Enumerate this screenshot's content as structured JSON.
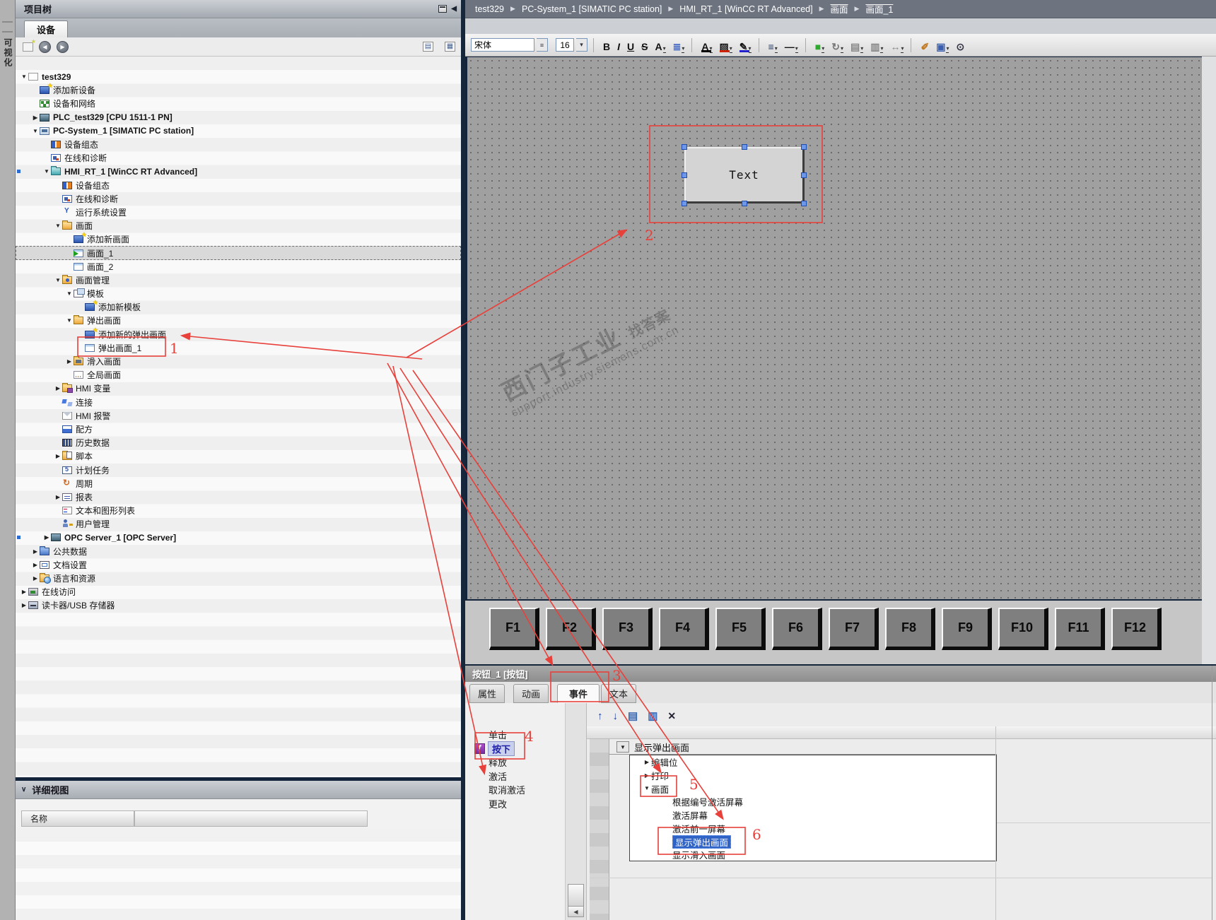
{
  "edge": {
    "vertical_label": "可视化"
  },
  "project_tree": {
    "title": "项目树",
    "device_tab": "设备",
    "detail_view_title": "详细视图",
    "name_header": "名称",
    "items": [
      {
        "t": "test329",
        "lv": 0,
        "ar": "d",
        "ic": "proj",
        "bold": true
      },
      {
        "t": "添加新设备",
        "lv": 1,
        "ic": "add st"
      },
      {
        "t": "设备和网络",
        "lv": 1,
        "ic": "net"
      },
      {
        "t": "PLC_test329 [CPU 1511-1 PN]",
        "lv": 1,
        "ar": "r",
        "ic": "plc",
        "bold": true
      },
      {
        "t": "PC-System_1 [SIMATIC PC station]",
        "lv": 1,
        "ar": "d",
        "ic": "pc",
        "bold": true
      },
      {
        "t": "设备组态",
        "lv": 2,
        "ic": "cfg"
      },
      {
        "t": "在线和诊断",
        "lv": 2,
        "ic": "diag"
      },
      {
        "t": "HMI_RT_1 [WinCC RT Advanced]",
        "lv": 2,
        "ar": "d",
        "ic": "hmi",
        "bold": true,
        "dot": true
      },
      {
        "t": "设备组态",
        "lv": 3,
        "ic": "cfg"
      },
      {
        "t": "在线和诊断",
        "lv": 3,
        "ic": "diag"
      },
      {
        "t": "运行系统设置",
        "lv": 3,
        "ic": "runtime bare"
      },
      {
        "t": "画面",
        "lv": 3,
        "ar": "d",
        "ic": "fld"
      },
      {
        "t": "添加新画面",
        "lv": 4,
        "ic": "addscr st"
      },
      {
        "t": "画面_1",
        "lv": 4,
        "ic": "scrplay",
        "sel": true
      },
      {
        "t": "画面_2",
        "lv": 4,
        "ic": "scr"
      },
      {
        "t": "画面管理",
        "lv": 3,
        "ar": "d",
        "ic": "fldw"
      },
      {
        "t": "模板",
        "lv": 4,
        "ar": "d",
        "ic": "tpl"
      },
      {
        "t": "添加新模板",
        "lv": 5,
        "ic": "addscr st"
      },
      {
        "t": "弹出画面",
        "lv": 4,
        "ar": "d",
        "ic": "fld"
      },
      {
        "t": "添加新的弹出画面",
        "lv": 5,
        "ic": "addscr st"
      },
      {
        "t": "弹出画面_1",
        "lv": 5,
        "ic": "scr"
      },
      {
        "t": "滑入画面",
        "lv": 4,
        "ar": "r",
        "ic": "fldd"
      },
      {
        "t": "全局画面",
        "lv": 4,
        "ic": "global"
      },
      {
        "t": "HMI 变量",
        "lv": 3,
        "ar": "r",
        "ic": "varfld"
      },
      {
        "t": "连接",
        "lv": 3,
        "ic": "conn bare"
      },
      {
        "t": "HMI 报警",
        "lv": 3,
        "ic": "alarm"
      },
      {
        "t": "配方",
        "lv": 3,
        "ic": "recipe"
      },
      {
        "t": "历史数据",
        "lv": 3,
        "ic": "hist"
      },
      {
        "t": "脚本",
        "lv": 3,
        "ar": "r",
        "ic": "scriptfld"
      },
      {
        "t": "计划任务",
        "lv": 3,
        "ic": "sched"
      },
      {
        "t": "周期",
        "lv": 3,
        "ic": "cycle bare"
      },
      {
        "t": "报表",
        "lv": 3,
        "ar": "r",
        "ic": "report"
      },
      {
        "t": "文本和图形列表",
        "lv": 3,
        "ic": "txtlist"
      },
      {
        "t": "用户管理",
        "lv": 3,
        "ic": "users bare"
      },
      {
        "t": "OPC Server_1 [OPC Server]",
        "lv": 2,
        "ar": "r",
        "ic": "opc",
        "bold": true,
        "dot": true
      },
      {
        "t": "公共数据",
        "lv": 1,
        "ar": "r",
        "ic": "common"
      },
      {
        "t": "文档设置",
        "lv": 1,
        "ar": "r",
        "ic": "docset"
      },
      {
        "t": "语言和资源",
        "lv": 1,
        "ar": "r",
        "ic": "lang"
      },
      {
        "t": "在线访问",
        "lv": 0,
        "ar": "r",
        "ic": "online"
      },
      {
        "t": "读卡器/USB 存储器",
        "lv": 0,
        "ar": "r",
        "ic": "card"
      }
    ]
  },
  "breadcrumb": {
    "items": [
      "test329",
      "PC-System_1 [SIMATIC PC station]",
      "HMI_RT_1 [WinCC RT Advanced]",
      "画面",
      "画面_1"
    ]
  },
  "format_toolbar": {
    "font_name": "宋体",
    "font_size": "16",
    "buttons": [
      {
        "name": "bold",
        "glyph": "B"
      },
      {
        "name": "italic",
        "glyph": "I",
        "cls": "it"
      },
      {
        "name": "underline",
        "glyph": "U",
        "cls": "un"
      },
      {
        "name": "strikethrough",
        "glyph": "S",
        "cls": "stk"
      },
      {
        "name": "font-size-adjust",
        "glyph": "A",
        "dd": true
      },
      {
        "name": "alignment",
        "glyph": "≣",
        "dd": true,
        "color": "#2b57c2"
      },
      {
        "sep": true
      },
      {
        "name": "font-color",
        "glyph": "A",
        "bar": "#000000",
        "dd": true
      },
      {
        "name": "background-color",
        "glyph": "▨",
        "bar": "#cc2200",
        "dd": true
      },
      {
        "name": "border-color",
        "glyph": "✎",
        "bar": "#2222cc",
        "dd": true
      },
      {
        "sep": true
      },
      {
        "name": "border-style",
        "glyph": "≡",
        "dd": true,
        "color": "#223a66"
      },
      {
        "name": "line-style",
        "glyph": "―",
        "dd": true
      },
      {
        "sep": true
      },
      {
        "name": "object-color",
        "glyph": "■",
        "dd": true,
        "color": "#2faa2f"
      },
      {
        "name": "rotate",
        "glyph": "↻",
        "dd": true,
        "color": "#777777"
      },
      {
        "name": "align-objects",
        "glyph": "▤",
        "dd": true,
        "color": "#888888"
      },
      {
        "name": "distribute-objects",
        "glyph": "▥",
        "dd": true,
        "color": "#888888"
      },
      {
        "name": "size-objects",
        "glyph": "↔",
        "dd": true,
        "color": "#888888"
      },
      {
        "sep": true
      },
      {
        "name": "format-paint",
        "glyph": "✐",
        "color": "#c07820"
      },
      {
        "name": "layers",
        "glyph": "▣",
        "dd": true,
        "color": "#3a5fae"
      },
      {
        "name": "zoom-select",
        "glyph": "⊙",
        "color": "#333344"
      }
    ]
  },
  "canvas": {
    "button_label": "Text",
    "watermark_main": "西门子工业",
    "watermark_tag": "找答案",
    "watermark_url": "support.industry.siemens.com.cn",
    "fkeys": [
      "F1",
      "F2",
      "F3",
      "F4",
      "F5",
      "F6",
      "F7",
      "F8",
      "F9",
      "F10",
      "F11",
      "F12"
    ]
  },
  "properties_panel": {
    "title": "按钮_1 [按钮]",
    "tabs": [
      "属性",
      "动画",
      "事件",
      "文本"
    ],
    "active_tab": "事件",
    "events": [
      {
        "label": "单击"
      },
      {
        "label": "按下",
        "selected": true
      },
      {
        "label": "释放"
      },
      {
        "label": "激活"
      },
      {
        "label": "取消激活"
      },
      {
        "label": "更改"
      }
    ],
    "function_toolbar": [
      {
        "name": "move-up",
        "glyph": "↑",
        "cls": "fi"
      },
      {
        "name": "move-down",
        "glyph": "↓",
        "cls": "fi"
      },
      {
        "name": "expand-all",
        "glyph": "▤",
        "cls": "fi f"
      },
      {
        "name": "collapse-all",
        "glyph": "▥",
        "cls": "fi f"
      },
      {
        "name": "delete",
        "glyph": "✕",
        "cls": "fi x"
      }
    ],
    "selected_function": "显示弹出画面",
    "function_tree": [
      {
        "label": "编辑位",
        "lv": 1,
        "ar": "r"
      },
      {
        "label": "打印",
        "lv": 1,
        "ar": "r"
      },
      {
        "label": "画面",
        "lv": 1,
        "ar": "d"
      },
      {
        "label": "根据编号激活屏幕",
        "lv": 2
      },
      {
        "label": "激活屏幕",
        "lv": 2
      },
      {
        "label": "激活前一屏幕",
        "lv": 2
      },
      {
        "label": "显示弹出画面",
        "lv": 2,
        "selected": true
      },
      {
        "label": "显示滑入画面",
        "lv": 2
      }
    ]
  },
  "annotations": {
    "n1": "1",
    "n2": "2",
    "n3": "3",
    "n4": "4",
    "n5": "5",
    "n6": "6",
    "color": "#e8403a"
  }
}
